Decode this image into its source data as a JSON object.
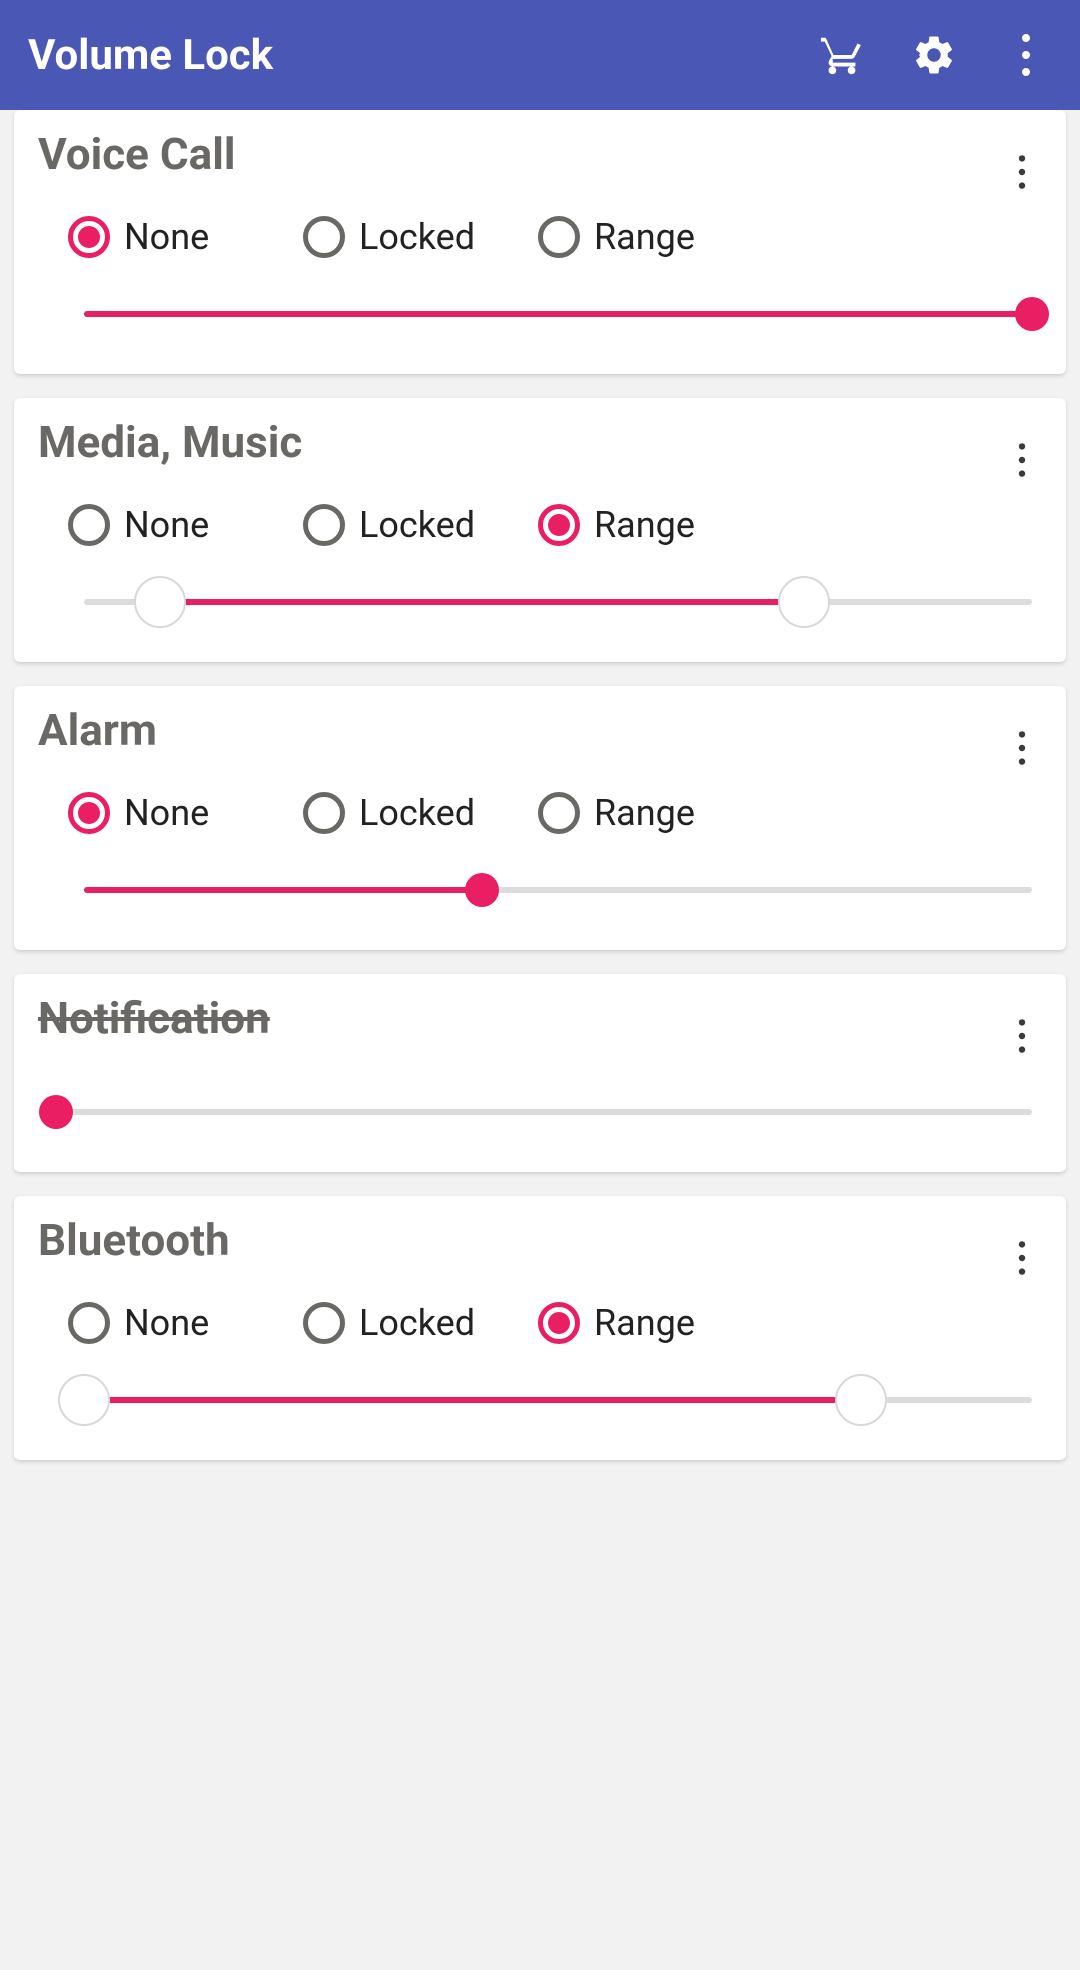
{
  "header": {
    "title": "Volume Lock"
  },
  "radio_labels": {
    "none": "None",
    "locked": "Locked",
    "range": "Range"
  },
  "cards": [
    {
      "title": "Voice Call",
      "disabled": false,
      "has_radios": true,
      "selected": "none",
      "slider": {
        "type": "single",
        "value": 100
      }
    },
    {
      "title": "Media, Music",
      "disabled": false,
      "has_radios": true,
      "selected": "range",
      "slider": {
        "type": "range",
        "low": 8,
        "high": 76
      }
    },
    {
      "title": "Alarm",
      "disabled": false,
      "has_radios": true,
      "selected": "none",
      "slider": {
        "type": "single",
        "value": 42
      }
    },
    {
      "title": "Notification",
      "disabled": true,
      "has_radios": false,
      "slider": {
        "type": "single",
        "value": 0
      }
    },
    {
      "title": "Bluetooth",
      "disabled": false,
      "has_radios": true,
      "selected": "range",
      "slider": {
        "type": "range",
        "low": 0,
        "high": 82
      }
    }
  ]
}
